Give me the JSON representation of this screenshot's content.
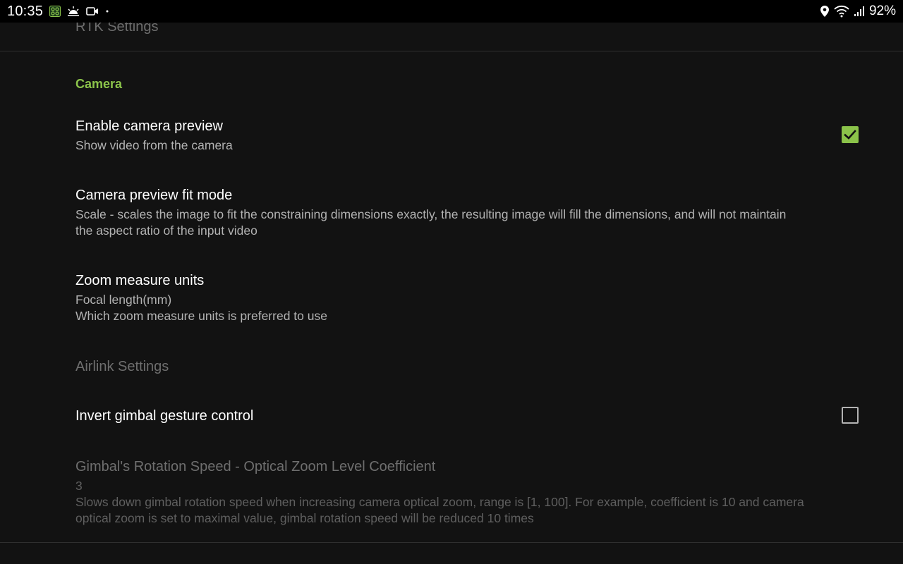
{
  "status_bar": {
    "time": "10:35",
    "battery_percent": "92%",
    "left_icons": [
      "app-icon",
      "weather-icon",
      "video-camera-icon",
      "dot-icon"
    ],
    "right_icons": [
      "location-icon",
      "wifi-icon",
      "signal-icon"
    ]
  },
  "settings": {
    "rtk_settings_label": "RTK Settings",
    "camera_category": "Camera",
    "enable_camera_preview": {
      "title": "Enable camera preview",
      "summary": "Show video from the camera",
      "checked": true
    },
    "camera_preview_fit_mode": {
      "title": "Camera preview fit mode",
      "summary_line1": "Scale - scales the image to fit the constraining dimensions exactly, the resulting image will fill the dimensions, and will not maintain",
      "summary_line2": "the aspect ratio of the input video"
    },
    "zoom_measure_units": {
      "title": "Zoom measure units",
      "value": "Focal length(mm)",
      "summary": "Which zoom measure units is preferred to use"
    },
    "airlink_settings_label": "Airlink Settings",
    "invert_gimbal_gesture_control": {
      "title": "Invert gimbal gesture control",
      "checked": false
    },
    "gimbal_rotation_speed": {
      "title": "Gimbal's Rotation Speed - Optical Zoom Level Coefficient",
      "value": "3",
      "summary_line1": "Slows down gimbal rotation speed when increasing camera optical zoom, range is [1, 100]. For example, coefficient is 10 and camera",
      "summary_line2": "optical zoom is set to maximal value, gimbal rotation speed will be reduced 10 times"
    }
  },
  "colors": {
    "accent": "#8bc34a",
    "background": "#121212",
    "status_bar": "#000000",
    "primary_text": "#ffffff",
    "secondary_text": "#b3b3b3",
    "disabled_text": "#6e6e6e"
  }
}
